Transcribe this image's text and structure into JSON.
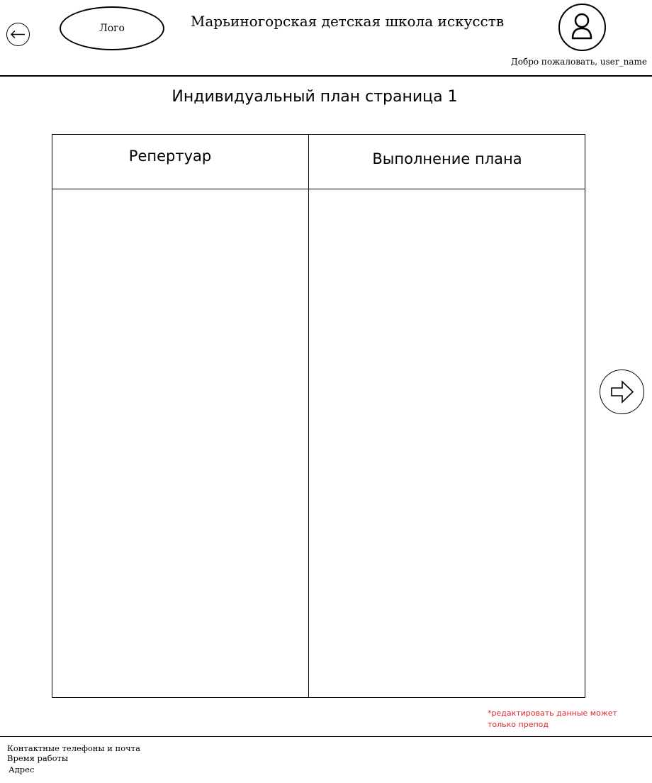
{
  "header": {
    "logo_label": "Лого",
    "school_title": "Марьиногорская детская школа искусств",
    "welcome_text": "Добро пожаловать, user_name",
    "back_icon": "arrow-left-icon",
    "avatar_icon": "user-icon"
  },
  "main": {
    "page_title": "Индивидуальный план страница 1",
    "table": {
      "columns": [
        "Репертуар",
        "Выполнение плана"
      ],
      "rows": []
    },
    "next_icon": "arrow-right-icon",
    "edit_note": "*редактировать данные может только препод"
  },
  "footer": {
    "contacts": "Контактные телефоны и почта",
    "hours": "Время работы",
    "address": "Адрес"
  },
  "colors": {
    "note": "#e0262b",
    "lines": "#000000",
    "background": "#ffffff"
  }
}
